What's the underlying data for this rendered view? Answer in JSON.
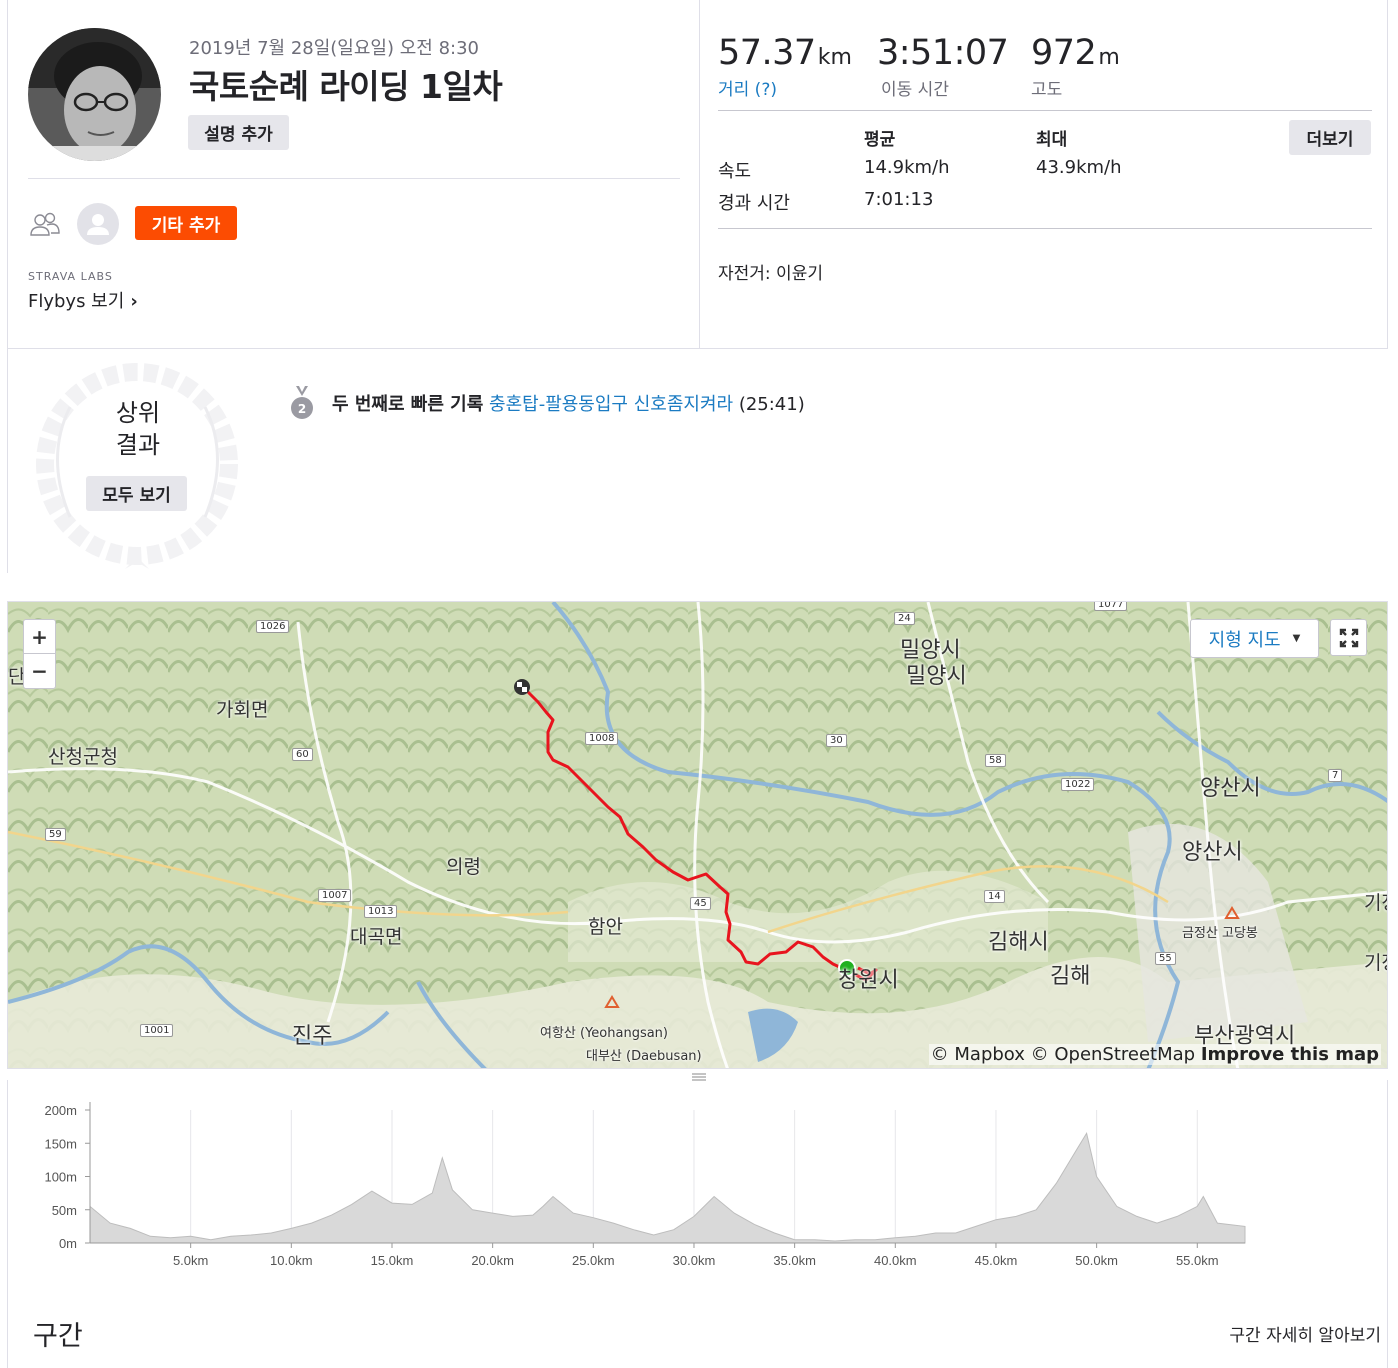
{
  "activity": {
    "date": "2019년 7월 28일(일요일) 오전 8:30",
    "title": "국토순례 라이딩 1일차",
    "add_description": "설명 추가",
    "add_others": "기타 추가",
    "labs_label": "STRAVA LABS",
    "flybys": "Flybys 보기",
    "flybys_chevron": "›"
  },
  "stats": {
    "distance": {
      "value": "57.37",
      "unit": "km",
      "label": "거리 (?)"
    },
    "moving_time": {
      "value": "3:51:07",
      "unit": "",
      "label": "이동 시간"
    },
    "elevation": {
      "value": "972",
      "unit": "m",
      "label": "고도"
    },
    "more_button": "더보기",
    "table": {
      "headers": [
        "평균",
        "최대"
      ],
      "rows": [
        {
          "label": "속도",
          "avg": "14.9km/h",
          "max": "43.9km/h"
        },
        {
          "label": "경과 시간",
          "avg": "7:01:13",
          "max": ""
        }
      ]
    },
    "bike": "자전거: 이윤기"
  },
  "achievements": {
    "top_results_line1": "상위",
    "top_results_line2": "결과",
    "see_all": "모두 보기",
    "medal_rank": "2",
    "record_prefix": "두 번째로 빠른 기록",
    "segment_name": "충혼탑-팔용동입구 신호좀지켜라",
    "segment_time": "(25:41)"
  },
  "map": {
    "zoom_in": "+",
    "zoom_out": "−",
    "map_type": "지형 지도",
    "attribution_1": "© Mapbox © OpenStreetMap",
    "attribution_2": "Improve this map",
    "route_color": "#e8141e",
    "start_color": "#20b020",
    "labels": [
      "가회면",
      "산청군청",
      "의령",
      "함안",
      "대곡면",
      "진주",
      "밀양시",
      "밀양시",
      "양산시",
      "양산시",
      "김해시",
      "김해",
      "부산광역시",
      "여항산 (Yeohangsan)",
      "대부산 (Daebusan)",
      "금정산 고당봉",
      "창원시",
      "기장",
      "기장",
      "단"
    ],
    "road_shields": [
      "1026",
      "60",
      "59",
      "1007",
      "1013",
      "1001",
      "1008",
      "30",
      "24",
      "58",
      "1022",
      "7",
      "45",
      "14",
      "55",
      "1077"
    ]
  },
  "elevation_chart": {
    "y_ticks": [
      "200m",
      "150m",
      "100m",
      "50m",
      "0m"
    ],
    "x_ticks": [
      "5.0km",
      "10.0km",
      "15.0km",
      "20.0km",
      "25.0km",
      "30.0km",
      "35.0km",
      "40.0km",
      "45.0km",
      "50.0km",
      "55.0km"
    ]
  },
  "chart_data": {
    "type": "area",
    "x": [
      0,
      1,
      2,
      3,
      4,
      5,
      6,
      7,
      8,
      9,
      10,
      11,
      12,
      13,
      14,
      15,
      16,
      17,
      17.5,
      18,
      19,
      20,
      21,
      22,
      22.5,
      23,
      24,
      25,
      26,
      27,
      28,
      29,
      30,
      31,
      32,
      33,
      34,
      35,
      36,
      37,
      38,
      39,
      40,
      41,
      42,
      43,
      44,
      45,
      46,
      47,
      48,
      49,
      49.5,
      50,
      51,
      52,
      53,
      54,
      55,
      55.3,
      56,
      57.37
    ],
    "y": [
      55,
      30,
      22,
      10,
      8,
      10,
      5,
      10,
      12,
      15,
      22,
      30,
      42,
      58,
      78,
      60,
      58,
      75,
      128,
      80,
      50,
      45,
      40,
      42,
      55,
      70,
      45,
      38,
      30,
      20,
      12,
      20,
      40,
      70,
      45,
      28,
      15,
      5,
      5,
      3,
      5,
      5,
      8,
      10,
      15,
      15,
      25,
      35,
      40,
      50,
      90,
      140,
      165,
      100,
      55,
      40,
      30,
      40,
      55,
      70,
      30,
      25
    ],
    "ylim": [
      0,
      200
    ],
    "xlim": [
      0,
      57.37
    ],
    "fill_color": "#d9d9d9",
    "xlabel": "",
    "ylabel": ""
  },
  "segments": {
    "title": "구간",
    "learn_more": "구간 자세히 알아보기"
  }
}
